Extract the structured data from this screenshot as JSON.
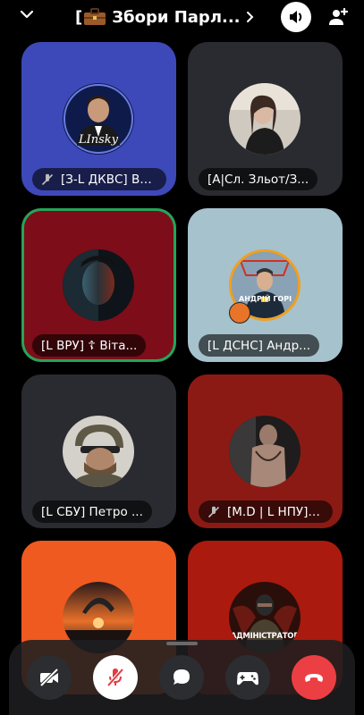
{
  "header": {
    "title": "Збори Парл...",
    "bracket": "[",
    "icons": {
      "back": "chevron-down-icon",
      "room": "briefcase-icon",
      "more": "chevron-right-icon",
      "speaker": "speaker-icon",
      "invite": "add-user-icon"
    }
  },
  "participants": [
    {
      "name": "[З-L ДКВС] Ва...",
      "muted": true,
      "color": "#3d49b8",
      "avatar_text": "LInsky"
    },
    {
      "name": "[A|Сл. Зльот/З...",
      "muted": false,
      "color": "#2a2b30"
    },
    {
      "name": "[L ВРУ] ☦ Віта...",
      "muted": false,
      "color": "#7d0d18",
      "speaking": true
    },
    {
      "name": "[L ДСНС] Андр...",
      "muted": false,
      "color": "#a6c2cc",
      "avatar_text": "АНДРІЙ ГОРІ"
    },
    {
      "name": "[L СБУ] Петро ...",
      "muted": false,
      "color": "#2a2b30"
    },
    {
      "name": "[M.D | L НПУ] В...",
      "muted": true,
      "color": "#8c1a14"
    },
    {
      "name": "",
      "muted": false,
      "color": "#ef5a20"
    },
    {
      "name": "",
      "muted": false,
      "color": "#aa1a0f",
      "avatar_text": "АДМІНІСТРАТОР"
    }
  ],
  "controls": [
    {
      "name": "camera-off-icon",
      "bg": "#2b2d31"
    },
    {
      "name": "mic-off-icon",
      "bg": "#ffffff"
    },
    {
      "name": "chat-icon",
      "bg": "#2b2d31"
    },
    {
      "name": "activities-icon",
      "bg": "#2b2d31"
    },
    {
      "name": "hang-up-icon",
      "bg": "#ec3f44"
    }
  ]
}
